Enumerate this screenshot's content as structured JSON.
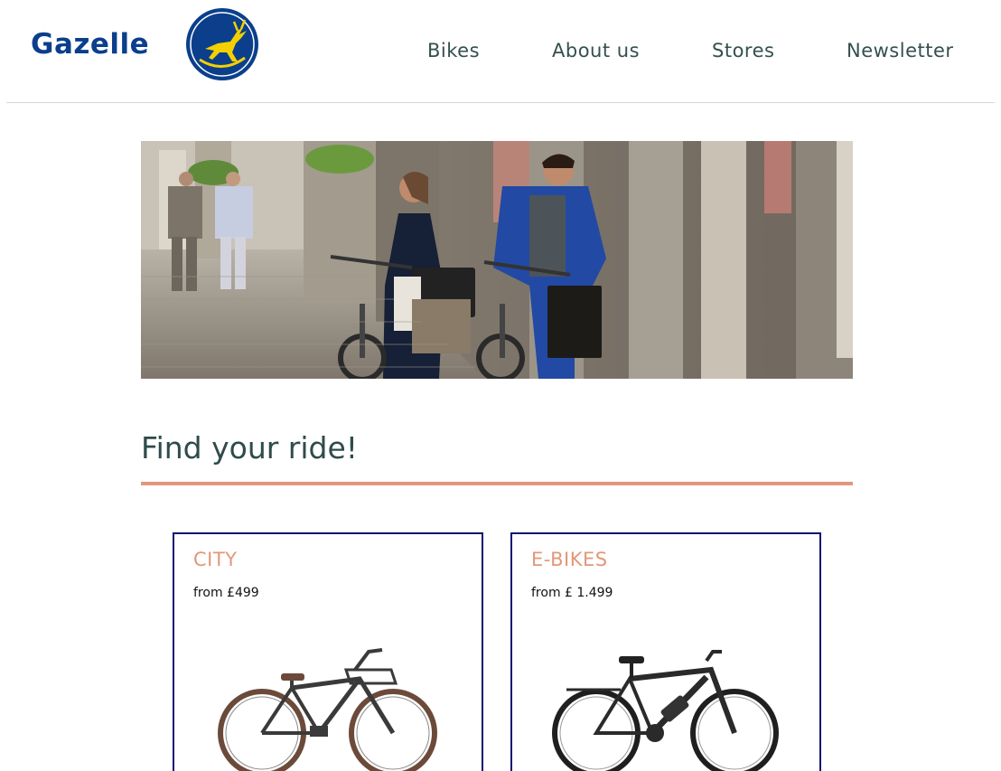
{
  "brand": {
    "name": "Gazelle",
    "logo_color": "#0b3f8c",
    "badge_accent": "#f5d000"
  },
  "nav": {
    "items": [
      {
        "label": "Bikes"
      },
      {
        "label": "About us"
      },
      {
        "label": "Stores"
      },
      {
        "label": "Newsletter"
      }
    ]
  },
  "hero": {
    "image": "couple-walking-bikes-street-photo"
  },
  "main": {
    "title": "Find your ride!",
    "accent": "#e3977a",
    "cards": [
      {
        "title": "CITY",
        "price": "from £499",
        "image": "city-bike-illustration"
      },
      {
        "title": "E-BIKES",
        "price": "from £ 1.499",
        "image": "e-bike-illustration"
      }
    ]
  }
}
